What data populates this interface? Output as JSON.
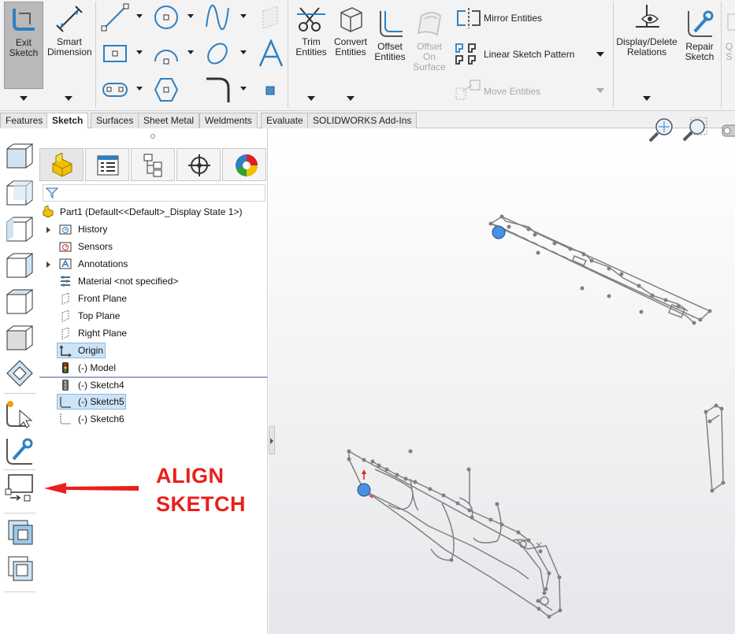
{
  "ribbon": {
    "exit_sketch": "Exit Sketch",
    "smart_dimension": [
      "Smart",
      "Dimension"
    ],
    "trim_entities": [
      "Trim",
      "Entities"
    ],
    "convert_entities": [
      "Convert",
      "Entities"
    ],
    "offset_entities": [
      "Offset",
      "Entities"
    ],
    "offset_on_surface": [
      "Offset",
      "On",
      "Surface"
    ],
    "mirror_entities": "Mirror Entities",
    "linear_sketch_pattern": "Linear Sketch Pattern",
    "move_entities": "Move Entities",
    "display_delete_relations": [
      "Display/Delete",
      "Relations"
    ],
    "repair_sketch": [
      "Repair",
      "Sketch"
    ],
    "cut_off": [
      "Q",
      "S"
    ]
  },
  "tabs": [
    "Features",
    "Sketch",
    "Surfaces",
    "Sheet Metal",
    "Weldments",
    "Evaluate",
    "SOLIDWORKS Add-Ins"
  ],
  "active_tab": "Sketch",
  "tree": {
    "root": "Part1  (Default<<Default>_Display State 1>)",
    "items": [
      "History",
      "Sensors",
      "Annotations",
      "Material <not specified>",
      "Front Plane",
      "Top Plane",
      "Right Plane",
      "Origin",
      "(-) Model",
      "(-) Sketch4",
      "(-) Sketch5",
      "(-) Sketch6"
    ]
  },
  "annotation": {
    "line1": "ALIGN",
    "line2": "SKETCH",
    "color": "#e8201b"
  },
  "colors": {
    "accent": "#1e6fb8",
    "selection": "#cde4f7",
    "origin_dot": "#4a90e2"
  }
}
